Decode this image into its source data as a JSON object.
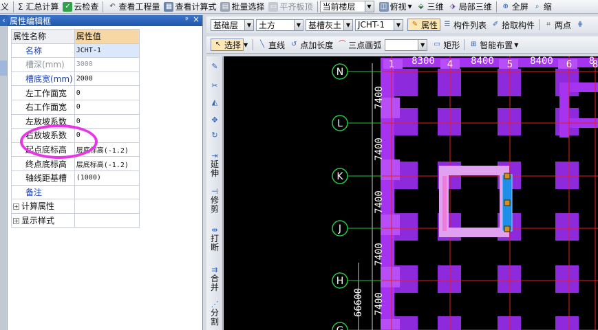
{
  "toolbar": {
    "items": [
      {
        "label": "定义",
        "icon": "define-icon"
      },
      {
        "label": "Σ 汇总计算",
        "icon": "sum-icon"
      },
      {
        "label": "云检查",
        "icon": "cloud-check-icon"
      },
      {
        "label": "查看工程量",
        "icon": "view-quantity-icon"
      },
      {
        "label": "查看计算式",
        "icon": "view-formula-icon"
      },
      {
        "label": "批量选择",
        "icon": "batch-select-icon"
      },
      {
        "label": "平齐板顶",
        "icon": "align-slab-icon",
        "disabled": true
      }
    ],
    "floor_select": "当前楼层",
    "view_items": [
      {
        "label": "俯视",
        "icon": "top-view-icon"
      },
      {
        "label": "三维",
        "icon": "3d-icon"
      },
      {
        "label": "局部三维",
        "icon": "local-3d-icon"
      },
      {
        "label": "全屏",
        "icon": "fullscreen-icon"
      },
      {
        "label": "缩",
        "icon": "zoom-icon"
      }
    ]
  },
  "panel": {
    "title": "属性编辑框",
    "pin": "ᵖ",
    "close": "×",
    "collapse": "‹",
    "header": {
      "name": "属性名称",
      "value": "属性值"
    },
    "rows": [
      {
        "name": "名称",
        "value": "JCHT-1",
        "style": "blue",
        "selected": true
      },
      {
        "name": "槽深(mm)",
        "value": "3000",
        "style": "gray"
      },
      {
        "name": "槽底宽(mm)",
        "value": "2000",
        "style": "blue"
      },
      {
        "name": "左工作面宽",
        "value": "0",
        "style": ""
      },
      {
        "name": "右工作面宽",
        "value": "0",
        "style": ""
      },
      {
        "name": "左放坡系数",
        "value": "0",
        "style": ""
      },
      {
        "name": "右放坡系数",
        "value": "0",
        "style": ""
      },
      {
        "name": "起点底标高",
        "value": "层底标高(-1.2)",
        "style": ""
      },
      {
        "name": "终点底标高",
        "value": "层底标高(-1.2)",
        "style": ""
      },
      {
        "name": "轴线距基槽",
        "value": "(1000)",
        "style": ""
      },
      {
        "name": "备注",
        "value": "",
        "style": "blue"
      }
    ],
    "groups": [
      "计算属性",
      "显示样式"
    ]
  },
  "row2": {
    "layer": "基础层",
    "category": "土方",
    "type": "基槽灰土",
    "component": "JCHT-1",
    "property_btn": "属性",
    "component_list": "构件列表",
    "pick_component": "拾取构件",
    "two_points": "两点"
  },
  "row3": {
    "select": "选择",
    "line": "直线",
    "point_add_length": "点加长度",
    "three_point_arc": "三点画弧",
    "rectangle": "矩形",
    "smart_layout": "智能布置"
  },
  "vtools": [
    {
      "label": "延伸",
      "icon": "extend-icon"
    },
    {
      "label": "修剪",
      "icon": "trim-icon"
    },
    {
      "label": "打断",
      "icon": "break-icon"
    },
    {
      "label": "合并",
      "icon": "merge-icon"
    },
    {
      "label": "分割",
      "icon": "split-icon"
    }
  ],
  "canvas": {
    "top_axes": [
      "1",
      "4",
      "5",
      "6",
      "8"
    ],
    "top_dims": [
      "8300",
      "8400",
      "8400",
      "8"
    ],
    "row_axes": [
      "N",
      "L",
      "K",
      "J",
      "H",
      "G"
    ],
    "row_dims": [
      "7400",
      "7400",
      "7400",
      "7400",
      "7400"
    ],
    "total_dim": "66600",
    "colors": {
      "background": "#000000",
      "column": "#8d2bdc",
      "beam": "#a533f0",
      "axis_line": "#e81e1e",
      "trench": "#1e8fe8"
    }
  }
}
